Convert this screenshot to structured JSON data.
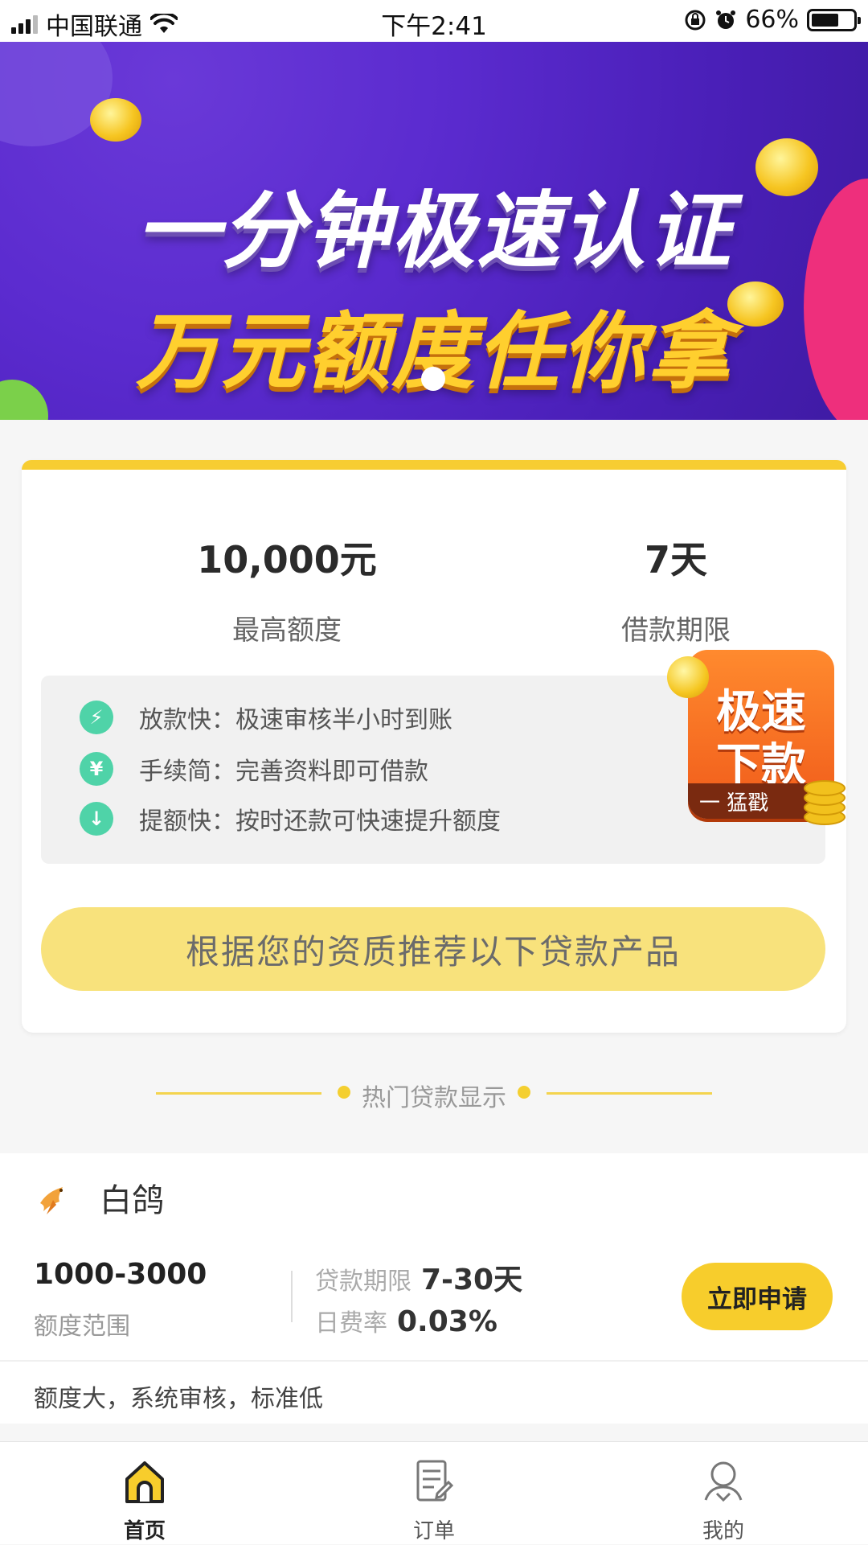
{
  "status_bar": {
    "carrier": "中国联通",
    "time": "下午2:41",
    "battery": "66%",
    "battery_level": 0.66
  },
  "banner": {
    "line1": "一分钟极速认证",
    "line2": "万元额度任你拿",
    "page_count": 1,
    "active_page": 1
  },
  "summary": {
    "max_amount": {
      "value": "10,000元",
      "label": "最高额度"
    },
    "term": {
      "value": "7天",
      "label": "借款期限"
    }
  },
  "features": [
    {
      "icon": "lightning-icon",
      "glyph": "⚡",
      "text": "放款快：极速审核半小时到账"
    },
    {
      "icon": "yen-icon",
      "glyph": "¥",
      "text": "手续简：完善资料即可借款"
    },
    {
      "icon": "arrow-down-icon",
      "glyph": "↓",
      "text": "提额快：按时还款可快速提升额度"
    }
  ],
  "sticker": {
    "line1": "极速",
    "line2": "下款",
    "footer": "一 猛戳"
  },
  "recommend_button": "根据您的资质推荐以下贷款产品",
  "section_title": "热门贷款显示",
  "product": {
    "name": "白鸽",
    "amount_range": "1000-3000",
    "amount_range_label": "额度范围",
    "term_label": "贷款期限",
    "term_value": "7-30天",
    "rate_label": "日费率",
    "rate_value": "0.03%",
    "apply_button": "立即申请",
    "description": "额度大，系统审核，标准低"
  },
  "tabbar": {
    "items": [
      {
        "label": "首页",
        "icon": "home-icon",
        "active": true
      },
      {
        "label": "订单",
        "icon": "order-icon",
        "active": false
      },
      {
        "label": "我的",
        "icon": "profile-icon",
        "active": false
      }
    ]
  },
  "colors": {
    "accent": "#f7cd2c",
    "feature_icon": "#4fd3a8",
    "banner_bg": "#5b2bcf"
  }
}
